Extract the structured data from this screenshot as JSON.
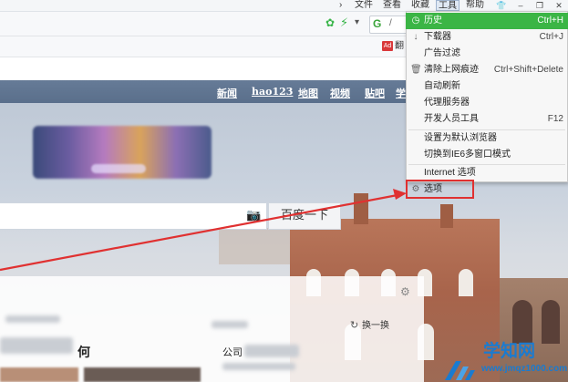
{
  "topbar": {
    "items": [
      "文件",
      "查看",
      "收藏",
      "工具",
      "帮助"
    ],
    "controls": [
      "shirt-icon",
      "minimize-icon",
      "restore-icon",
      "close-icon"
    ]
  },
  "toolbar": {
    "search_engine_glyph": "G",
    "search_text": "/",
    "adblock_badge": "Ad",
    "adblock_label": "翻"
  },
  "nav": {
    "links": [
      "新闻",
      "hao123",
      "地图",
      "视频",
      "贴吧",
      "学"
    ]
  },
  "search": {
    "button_label": "百度一下"
  },
  "content": {
    "swap_label": "换一换",
    "feed_title_a": "何",
    "feed_title_b": "公司"
  },
  "menu": {
    "items": [
      {
        "label": "历史",
        "shortcut": "Ctrl+H",
        "icon": "history-icon",
        "highlighted": true
      },
      {
        "label": "下载器",
        "shortcut": "Ctrl+J",
        "icon": "download-icon"
      },
      {
        "label": "广告过滤",
        "shortcut": "",
        "icon": ""
      },
      {
        "label": "清除上网痕迹",
        "shortcut": "Ctrl+Shift+Delete",
        "icon": "trash-icon"
      },
      {
        "label": "自动刷新",
        "shortcut": "",
        "icon": ""
      },
      {
        "label": "代理服务器",
        "shortcut": "",
        "icon": ""
      },
      {
        "label": "开发人员工具",
        "shortcut": "F12",
        "icon": ""
      },
      {
        "label": "设置为默认浏览器",
        "shortcut": "",
        "icon": ""
      },
      {
        "label": "切换到IE6多窗口模式",
        "shortcut": "",
        "icon": ""
      },
      {
        "label": "Internet 选项",
        "shortcut": "",
        "icon": ""
      },
      {
        "label": "选项",
        "shortcut": "",
        "icon": "gear-icon"
      }
    ],
    "highlight_color": "#3bb545",
    "callout_color": "#e03131"
  },
  "watermark": {
    "name": "学知网",
    "url": "www.jmqz1000.com"
  }
}
